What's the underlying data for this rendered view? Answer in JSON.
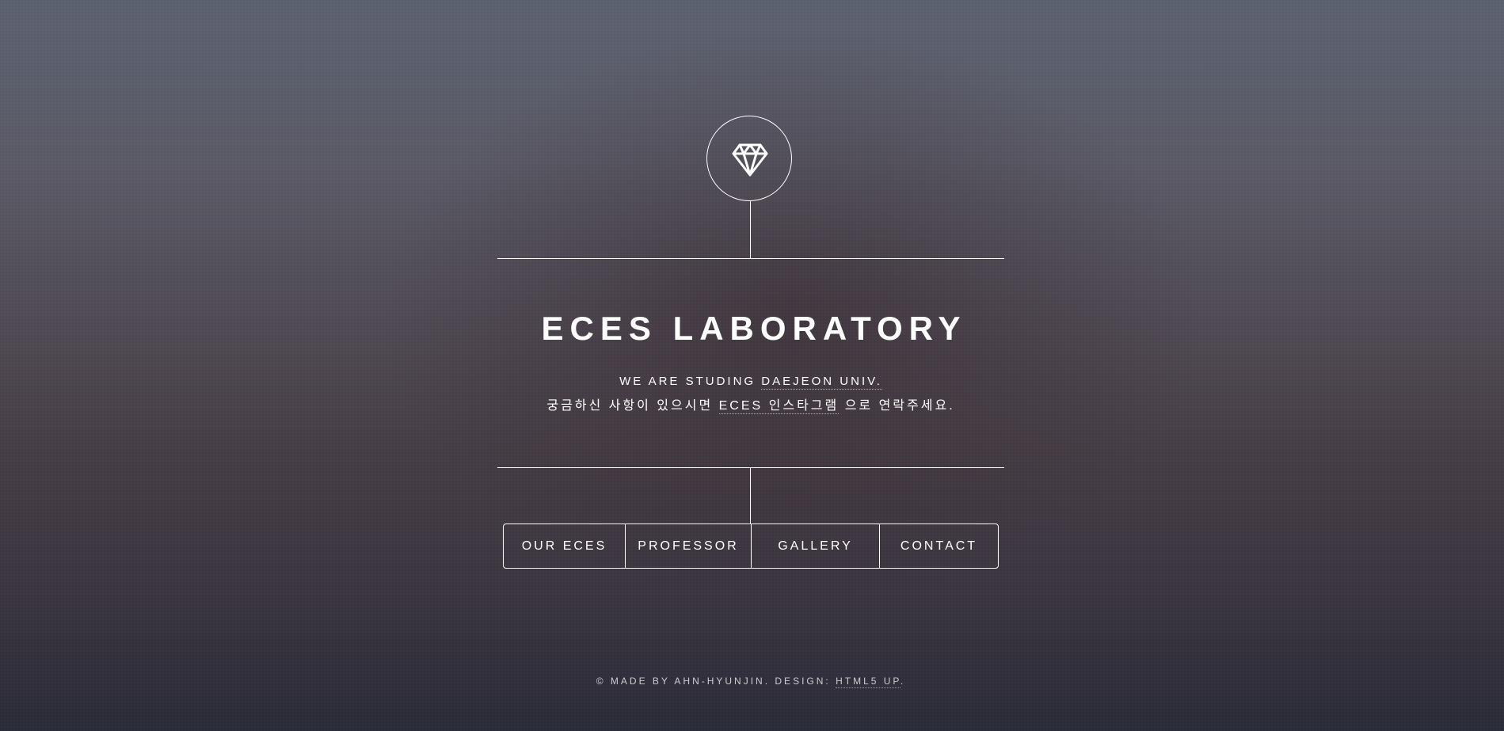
{
  "header": {
    "logo_icon": "diamond-icon"
  },
  "intro": {
    "title": "ECES LABORATORY",
    "line1_prefix": "WE ARE STUDING",
    "line1_link": "DAEJEON UNIV.",
    "line2_prefix": "궁금하신 사항이 있으시면",
    "line2_link": "ECES 인스타그램",
    "line2_suffix": "으로 연락주세요."
  },
  "nav": {
    "items": [
      {
        "label": "OUR ECES"
      },
      {
        "label": "PROFESSOR"
      },
      {
        "label": "GALLERY"
      },
      {
        "label": "CONTACT"
      }
    ]
  },
  "footer": {
    "credit_text": "© MADE BY AHN-HYUNJIN. DESIGN:",
    "design_link": "HTML5 UP",
    "end_punct": "."
  },
  "colors": {
    "foreground": "#ffffff",
    "background_top": "#5b606f",
    "background_bottom": "#2a2b38"
  }
}
